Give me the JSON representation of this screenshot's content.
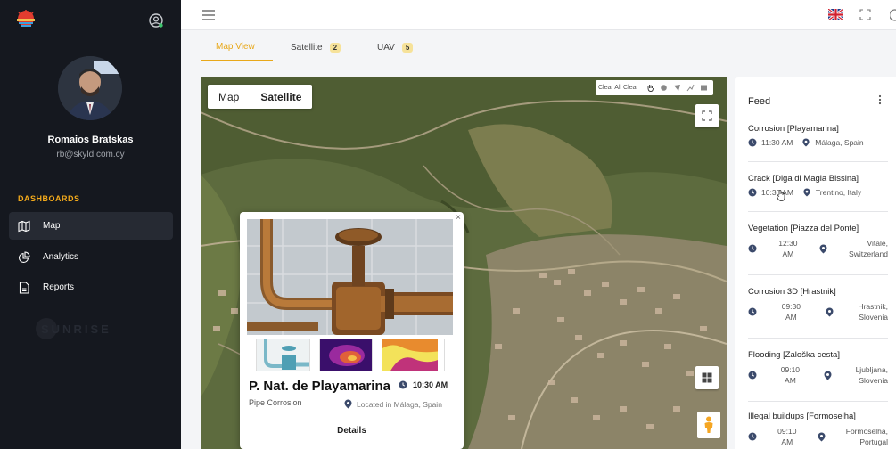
{
  "sidebar": {
    "user": {
      "name": "Romaios Bratskas",
      "email": "rb@skyld.com.cy"
    },
    "section": "DASHBOARDS",
    "items": [
      {
        "label": "Map",
        "icon": "map-icon",
        "active": true
      },
      {
        "label": "Analytics",
        "icon": "chart-pie-icon",
        "active": false
      },
      {
        "label": "Reports",
        "icon": "document-icon",
        "active": false
      }
    ],
    "watermark": "SUNRISE"
  },
  "tabs": [
    {
      "label": "Map View",
      "badge": ""
    },
    {
      "label": "Satellite",
      "badge": "2"
    },
    {
      "label": "UAV",
      "badge": "5"
    }
  ],
  "map": {
    "type_options": [
      "Map",
      "Satellite"
    ],
    "selected_type": "Satellite",
    "clear_label": "Clear All Clear"
  },
  "popup": {
    "title": "P. Nat. de Playamarina",
    "time": "10:30 AM",
    "subtitle": "Pipe Corrosion",
    "location": "Located in Málaga, Spain",
    "details_label": "Details",
    "close": "×"
  },
  "feed": {
    "title": "Feed",
    "items": [
      {
        "title": "Corrosion [Playamarina]",
        "time": "11:30 AM",
        "location": "Málaga, Spain",
        "stacked": false
      },
      {
        "title": "Crack [Diga di Magla Bissina]",
        "time": "10:30 AM",
        "location": "Trentino, Italy",
        "stacked": false
      },
      {
        "title": "Vegetation [Piazza del Ponte]",
        "time_a": "12:30",
        "time_b": "AM",
        "loc_a": "Vitale,",
        "loc_b": "Switzerland",
        "stacked": true
      },
      {
        "title": "Corrosion 3D [Hrastnik]",
        "time_a": "09:30",
        "time_b": "AM",
        "loc_a": "Hrastnik,",
        "loc_b": "Slovenia",
        "stacked": true
      },
      {
        "title": "Flooding [Zaloška cesta]",
        "time_a": "09:10",
        "time_b": "AM",
        "loc_a": "Ljubljana,",
        "loc_b": "Slovenia",
        "stacked": true
      },
      {
        "title": "Illegal buildups [Formoselha]",
        "time_a": "09:10",
        "time_b": "AM",
        "loc_a": "Formoselha,",
        "loc_b": "Portugal",
        "stacked": true
      }
    ]
  },
  "colors": {
    "accent": "#e8a81a",
    "sidebar": "#15181f",
    "icon": "#3b4a6b"
  }
}
